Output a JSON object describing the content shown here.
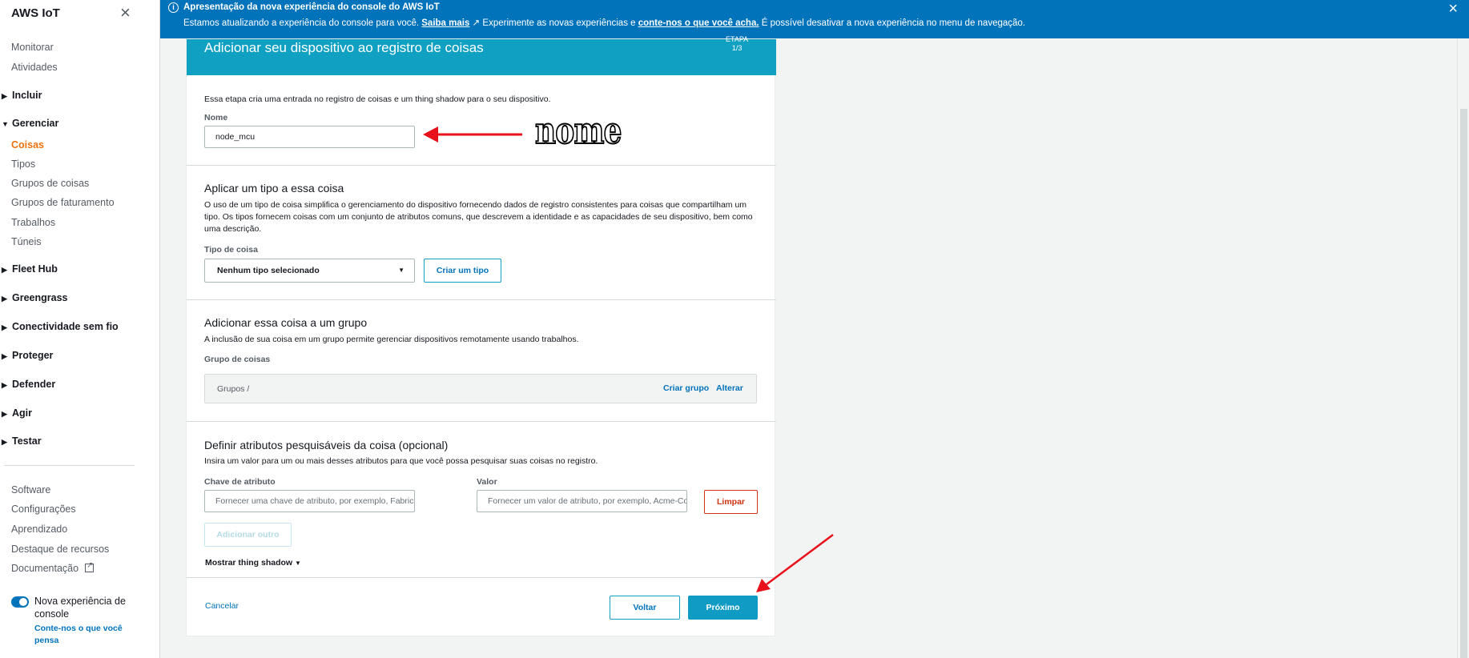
{
  "sidebar": {
    "title": "AWS IoT",
    "top_links": [
      "Monitorar",
      "Atividades"
    ],
    "sections": {
      "incluir": "Incluir",
      "gerenciar": "Gerenciar",
      "fleet_hub": "Fleet Hub",
      "greengrass": "Greengrass",
      "conectividade": "Conectividade sem fio",
      "proteger": "Proteger",
      "defender": "Defender",
      "agir": "Agir",
      "testar": "Testar"
    },
    "gerenciar_items": [
      "Coisas",
      "Tipos",
      "Grupos de coisas",
      "Grupos de faturamento",
      "Trabalhos",
      "Túneis"
    ],
    "bottom_links": [
      "Software",
      "Configurações",
      "Aprendizado",
      "Destaque de recursos",
      "Documentação"
    ],
    "toggle_label": "Nova experiência de console",
    "toggle_on": true,
    "feedback_link": "Conte-nos o que você pensa",
    "active_item": "Coisas"
  },
  "banner": {
    "title": "Apresentação da nova experiência do console do AWS IoT",
    "text_1": "Estamos atualizando a experiência do console para você. ",
    "link_1": "Saiba mais",
    "text_2": " Experimente as novas experiências e ",
    "link_2": "conte-nos o que você acha.",
    "text_3": " É possível desativar a nova experiência no menu de navegação."
  },
  "panel": {
    "title": "Adicionar seu dispositivo ao registro de coisas",
    "step_label": "ETAPA",
    "step_value": "1/3",
    "intro": "Essa etapa cria uma entrada no registro de coisas e um thing shadow para o seu dispositivo.",
    "name_label": "Nome",
    "name_value": "node_mcu",
    "type_section": {
      "heading": "Aplicar um tipo a essa coisa",
      "description": "O uso de um tipo de coisa simplifica o gerenciamento do dispositivo fornecendo dados de registro consistentes para coisas que compartilham um tipo. Os tipos fornecem coisas com um conjunto de atributos comuns, que descrevem a identidade e as capacidades de seu dispositivo, bem como uma descrição.",
      "field_label": "Tipo de coisa",
      "selected": "Nenhum tipo selecionado",
      "create_button": "Criar um tipo"
    },
    "group_section": {
      "heading": "Adicionar essa coisa a um grupo",
      "description": "A inclusão de sua coisa em um grupo permite gerenciar dispositivos remotamente usando trabalhos.",
      "field_label": "Grupo de coisas",
      "path": "Grupos /",
      "create_link": "Criar grupo",
      "change_link": "Alterar"
    },
    "attributes_section": {
      "heading": "Definir atributos pesquisáveis da coisa (opcional)",
      "description": "Insira um valor para um ou mais desses atributos para que você possa pesquisar suas coisas no registro.",
      "key_label": "Chave de atributo",
      "key_placeholder": "Fornecer uma chave de atributo, por exemplo, Fabricante",
      "value_label": "Valor",
      "value_placeholder": "Fornecer um valor de atributo, por exemplo, Acme-Corporation",
      "clear_button": "Limpar",
      "add_button": "Adicionar outro",
      "shadow_toggle": "Mostrar thing shadow"
    },
    "footer": {
      "cancel": "Cancelar",
      "back": "Voltar",
      "next": "Próximo"
    }
  },
  "annotation": {
    "text": "nome",
    "arrow_color": "#e8101a"
  },
  "colors": {
    "accent": "#0073bb",
    "header": "#0fa0c2",
    "active": "#ec7211",
    "danger": "#d13212"
  }
}
